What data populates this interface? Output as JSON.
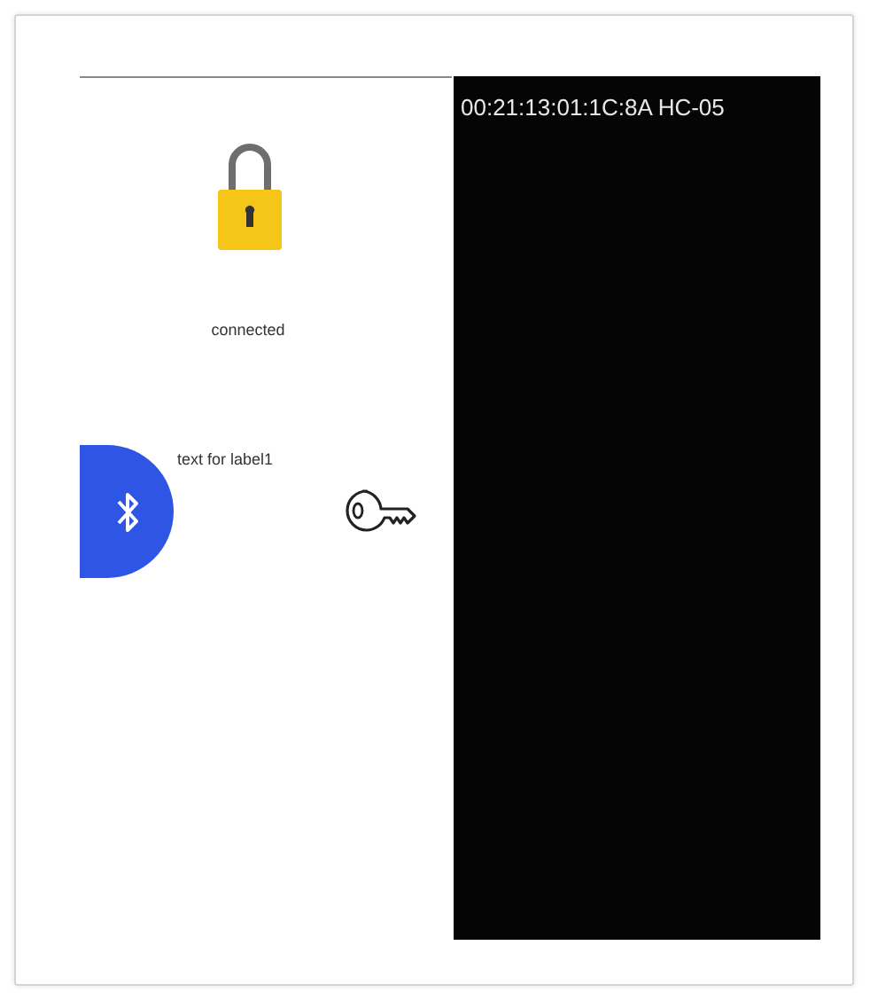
{
  "status_label": "connected",
  "label1": "text for label1",
  "device_list": [
    {
      "text": "00:21:13:01:1C:8A HC-05"
    }
  ]
}
